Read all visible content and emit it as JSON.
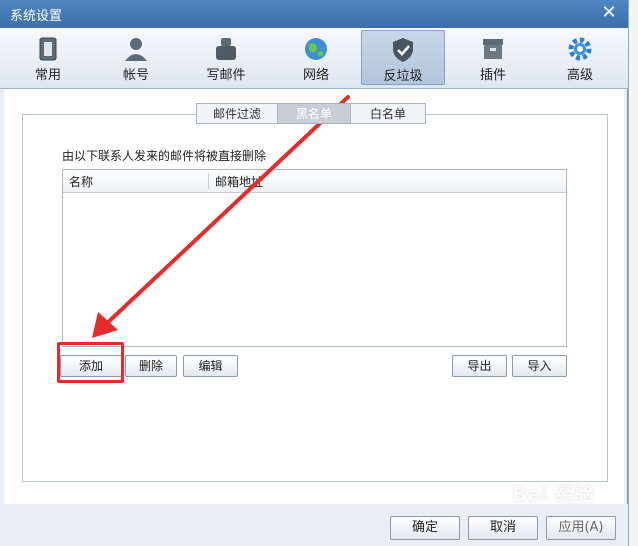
{
  "window": {
    "title": "系统设置"
  },
  "toolbar": {
    "items": [
      {
        "label": "常用",
        "icon": "general-icon"
      },
      {
        "label": "帐号",
        "icon": "account-icon"
      },
      {
        "label": "写邮件",
        "icon": "compose-icon"
      },
      {
        "label": "网络",
        "icon": "network-icon"
      },
      {
        "label": "反垃圾",
        "icon": "antispam-shield-icon",
        "active": true
      },
      {
        "label": "插件",
        "icon": "plugin-box-icon"
      },
      {
        "label": "高级",
        "icon": "advanced-gear-icon"
      }
    ]
  },
  "subtabs": {
    "items": [
      "邮件过滤",
      "黑名单",
      "白名单"
    ],
    "selected": "黑名单"
  },
  "blacklist": {
    "hint": "由以下联系人发来的邮件将被直接删除",
    "columns": [
      "名称",
      "邮箱地址"
    ],
    "rows": []
  },
  "buttons": {
    "add": "添加",
    "delete": "删除",
    "edit": "编辑",
    "export": "导出",
    "import": "导入"
  },
  "footer": {
    "ok": "确定",
    "cancel": "取消",
    "apply": "应用(A)"
  },
  "watermark": "Bai 经验",
  "colors": {
    "annotation": "#e62b2b",
    "title_bar": "#3b6fa9"
  }
}
